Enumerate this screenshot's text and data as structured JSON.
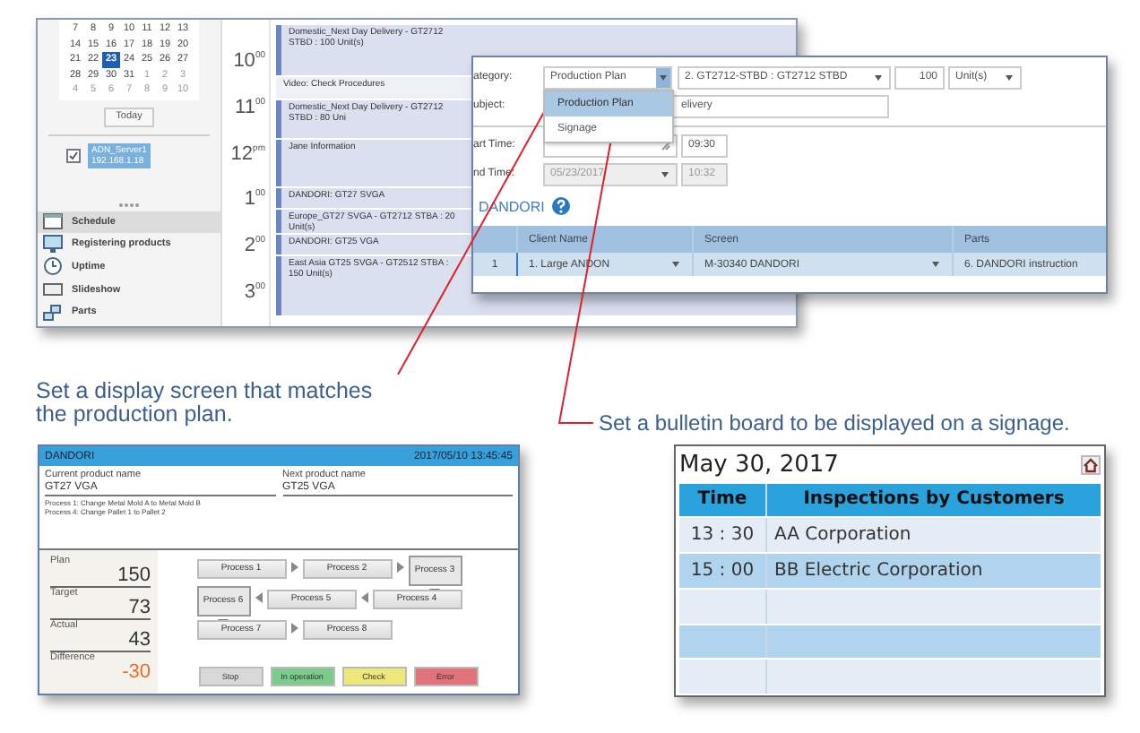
{
  "schedule_window": {
    "mini_calendar": {
      "weeks": [
        [
          {
            "day": "7",
            "selected": false,
            "muted": false
          },
          {
            "day": "8",
            "selected": false,
            "muted": false
          },
          {
            "day": "9",
            "selected": false,
            "muted": false
          },
          {
            "day": "10",
            "selected": false,
            "muted": false
          },
          {
            "day": "11",
            "selected": false,
            "muted": false
          },
          {
            "day": "12",
            "selected": false,
            "muted": false
          },
          {
            "day": "13",
            "selected": false,
            "muted": false
          }
        ],
        [
          {
            "day": "14",
            "selected": false,
            "muted": false
          },
          {
            "day": "15",
            "selected": false,
            "muted": false
          },
          {
            "day": "16",
            "selected": false,
            "muted": false
          },
          {
            "day": "17",
            "selected": false,
            "muted": false
          },
          {
            "day": "18",
            "selected": false,
            "muted": false
          },
          {
            "day": "19",
            "selected": false,
            "muted": false
          },
          {
            "day": "20",
            "selected": false,
            "muted": false
          }
        ],
        [
          {
            "day": "21",
            "selected": false,
            "muted": false
          },
          {
            "day": "22",
            "selected": false,
            "muted": false
          },
          {
            "day": "23",
            "selected": true,
            "muted": false
          },
          {
            "day": "24",
            "selected": false,
            "muted": false
          },
          {
            "day": "25",
            "selected": false,
            "muted": false
          },
          {
            "day": "26",
            "selected": false,
            "muted": false
          },
          {
            "day": "27",
            "selected": false,
            "muted": false
          }
        ],
        [
          {
            "day": "28",
            "selected": false,
            "muted": false
          },
          {
            "day": "29",
            "selected": false,
            "muted": false
          },
          {
            "day": "30",
            "selected": false,
            "muted": false
          },
          {
            "day": "31",
            "selected": false,
            "muted": false
          },
          {
            "day": "1",
            "selected": false,
            "muted": true
          },
          {
            "day": "2",
            "selected": false,
            "muted": true
          },
          {
            "day": "3",
            "selected": false,
            "muted": true
          }
        ],
        [
          {
            "day": "4",
            "selected": false,
            "muted": true
          },
          {
            "day": "5",
            "selected": false,
            "muted": true
          },
          {
            "day": "6",
            "selected": false,
            "muted": true
          },
          {
            "day": "7",
            "selected": false,
            "muted": true
          },
          {
            "day": "8",
            "selected": false,
            "muted": true
          },
          {
            "day": "9",
            "selected": false,
            "muted": true
          },
          {
            "day": "10",
            "selected": false,
            "muted": true
          }
        ]
      ],
      "today_button": "Today"
    },
    "calendars": [
      {
        "name": "ADN_Server1",
        "address": "192.168.1.18",
        "checked": true
      }
    ],
    "nav": [
      {
        "label": "Schedule",
        "selected": true
      },
      {
        "label": "Registering products",
        "selected": false
      },
      {
        "label": "Uptime",
        "selected": false
      },
      {
        "label": "Slideshow",
        "selected": false
      },
      {
        "label": "Parts",
        "selected": false
      }
    ],
    "hours": [
      "10$^{00}$",
      "11$^{00}$",
      "12$^{pm}$",
      "1$^{00}$",
      "2$^{00}$",
      "3$^{00}$"
    ],
    "events": [
      {
        "title": "Domestic_Next Day Delivery - GT2712 STBD : 100 Unit(s)",
        "kind": "appointment"
      },
      {
        "title": "Video: Check Procedures",
        "kind": "note"
      },
      {
        "title": "Domestic_Next Day Delivery - GT2712 STBD : 80 Uni",
        "kind": "appointment"
      },
      {
        "title": "Jane Information",
        "kind": "appointment"
      },
      {
        "title": "DANDORI: GT27 SVGA",
        "kind": "appointment"
      },
      {
        "title": "Europe_GT27 SVGA - GT2712 STBA : 20 Unit(s)",
        "kind": "appointment"
      },
      {
        "title": "DANDORI: GT25 VGA",
        "kind": "appointment"
      },
      {
        "title": "East Asia GT25 SVGA - GT2512 STBA : 150 Unit(s)",
        "kind": "appointment"
      }
    ]
  },
  "dialog": {
    "category": {
      "label": "ategory:",
      "value": "Production Plan",
      "expanded": true,
      "options": [
        {
          "label": "Production Plan",
          "selected": true
        },
        {
          "label": "Signage",
          "selected": false
        }
      ]
    },
    "product": "2. GT2712-STBD : GT2712 STBD",
    "quantity": "100",
    "unit": "Unit(s)",
    "subject": {
      "label": "ubject:",
      "value": "elivery"
    },
    "start": {
      "label": "art Time:",
      "time": "09:30"
    },
    "end": {
      "label": "nd Time:",
      "date": "05/23/2017",
      "time": "10:32",
      "disabled": true
    },
    "section_link": "DANDORI",
    "table": {
      "columns": [
        "Client Name",
        "Screen",
        "Parts"
      ],
      "rows": [
        {
          "number": "1",
          "client": "1. Large ANDON",
          "screen": "M-30340 DANDORI",
          "parts": "6. DANDORI instruction"
        }
      ]
    }
  },
  "captions": [
    "Set a display screen that matches the production plan.",
    "Set a bulletin board to be displayed on a signage."
  ],
  "dandori_screen": {
    "title": "DANDORI",
    "timestamp": "2017/05/10 13:45:45",
    "current_label": "Current product name",
    "current_value": "GT27 VGA",
    "next_label": "Next product name",
    "next_value": "GT25 VGA",
    "notes": [
      "Process 1: Change Metal Mold A to Metal Mold B",
      "Process 4: Change Pallet 1 to Pallet 2"
    ],
    "stats": [
      {
        "label": "Plan",
        "value": "150",
        "negative": false
      },
      {
        "label": "Target",
        "value": "73",
        "negative": false
      },
      {
        "label": "Actual",
        "value": "43",
        "negative": false
      },
      {
        "label": "Difference",
        "value": "-30",
        "negative": true
      }
    ],
    "process_rows": [
      {
        "kind": "forward",
        "items": [
          {
            "label": "Process 1",
            "highlighted": false
          },
          {
            "label": "Process 2",
            "highlighted": false
          },
          {
            "label": "Process 3",
            "highlighted": true
          }
        ]
      },
      {
        "kind": "backward",
        "items": [
          {
            "label": "Process 6",
            "highlighted": true
          },
          {
            "label": "Process 5",
            "highlighted": false
          },
          {
            "label": "Process 4",
            "highlighted": false
          }
        ]
      },
      {
        "kind": "forward",
        "items": [
          {
            "label": "Process 7",
            "highlighted": false
          },
          {
            "label": "Process 8",
            "highlighted": false
          }
        ]
      }
    ],
    "status_buttons": [
      {
        "label": "Stop",
        "color": "#d8d8d8"
      },
      {
        "label": "In operation",
        "color": "#7ccb8c"
      },
      {
        "label": "Check",
        "color": "#ece87a"
      },
      {
        "label": "Error",
        "color": "#e2727c"
      }
    ]
  },
  "signage": {
    "date": "May 30, 2017",
    "columns": [
      "Time",
      "Inspections by Customers"
    ],
    "rows": [
      {
        "time": "13 : 30",
        "customer": "AA Corporation"
      },
      {
        "time": "15 : 00",
        "customer": "BB Electric Corporation"
      }
    ]
  }
}
